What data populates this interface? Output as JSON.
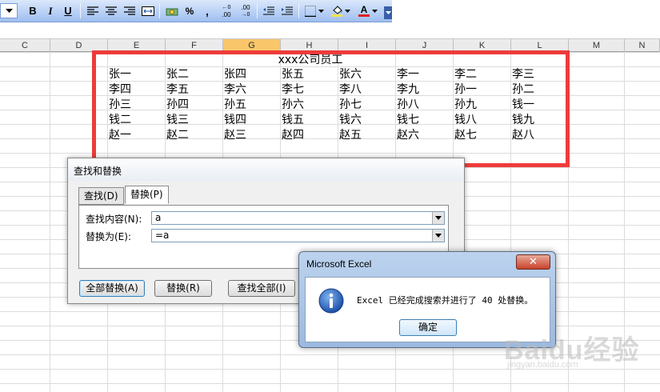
{
  "toolbar": {
    "bold": "B",
    "italic": "I",
    "underline": "U",
    "percent": "%",
    "comma": ",",
    "increase_decimal": ".00",
    "decrease_decimal": ".00",
    "fill_letter": "A",
    "font_color_letter": "A",
    "icons": [
      "bold-icon",
      "italic-icon",
      "underline-icon",
      "align-left-icon",
      "align-center-icon",
      "align-right-icon",
      "merge-center-icon",
      "currency-icon",
      "percent-icon",
      "comma-icon",
      "increase-decimal-icon",
      "decrease-decimal-icon",
      "decrease-indent-icon",
      "increase-indent-icon",
      "borders-icon",
      "fill-color-icon",
      "font-color-icon"
    ],
    "colors": {
      "fill": "#f5e34a",
      "font": "#e02020"
    }
  },
  "columns": [
    "C",
    "D",
    "E",
    "F",
    "G",
    "H",
    "I",
    "J",
    "K",
    "L",
    "M",
    "N"
  ],
  "selected_column": "G",
  "sheet": {
    "title": "xxx公司员工",
    "rows": [
      [
        "张一",
        "张二",
        "张四",
        "张五",
        "张六",
        "李一",
        "李二",
        "李三"
      ],
      [
        "李四",
        "李五",
        "李六",
        "李七",
        "李八",
        "李九",
        "孙一",
        "孙二"
      ],
      [
        "孙三",
        "孙四",
        "孙五",
        "孙六",
        "孙七",
        "孙八",
        "孙九",
        "钱一"
      ],
      [
        "钱二",
        "钱三",
        "钱四",
        "钱五",
        "钱六",
        "钱七",
        "钱八",
        "钱九"
      ],
      [
        "赵一",
        "赵二",
        "赵三",
        "赵四",
        "赵五",
        "赵六",
        "赵七",
        "赵八"
      ]
    ]
  },
  "find_dialog": {
    "title": "查找和替换",
    "tab_find": "查找(D)",
    "tab_replace": "替换(P)",
    "find_label": "查找内容(N):",
    "find_value": "a",
    "replace_label": "替换为(E):",
    "replace_value": "=a",
    "replace_all": "全部替换(A)",
    "replace": "替换(R)",
    "find_all": "查找全部(I)"
  },
  "message_box": {
    "title": "Microsoft Excel",
    "text": "Excel 已经完成搜索并进行了 40 处替换。",
    "ok": "确定",
    "close": "✕"
  },
  "watermark": {
    "brand": "Baidu经验",
    "url": "jingyan.baidu.com"
  }
}
